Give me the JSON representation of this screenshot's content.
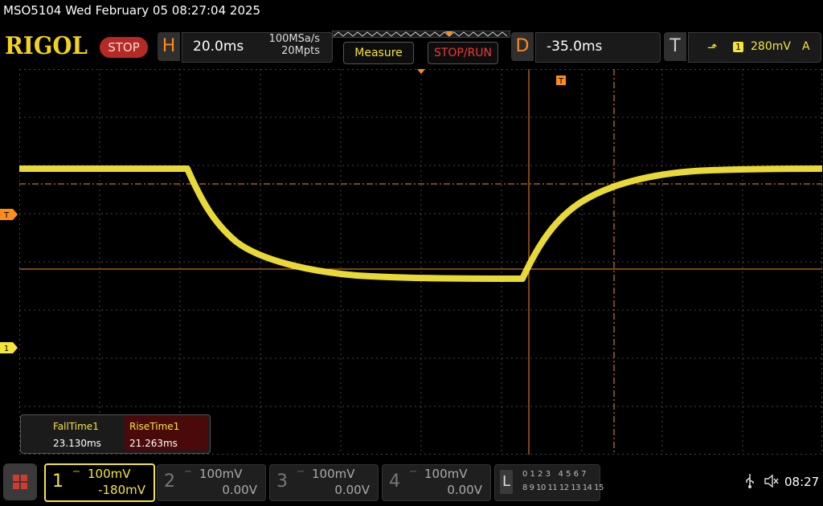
{
  "title": "MSO5104  Wed February 05 08:27:04 2025",
  "header": {
    "logo": "RIGOL",
    "run_state": "STOP",
    "horizontal": {
      "key": "H",
      "timebase": "20.0ms",
      "sample_rate": "100MSa/s",
      "memory_depth": "20Mpts"
    },
    "measure_label": "Measure",
    "stoprun_label": "STOP/RUN",
    "delay": {
      "key": "D",
      "value": "-35.0ms"
    },
    "trigger": {
      "key": "T",
      "edge": "rising-edge-icon",
      "edge_glyph": "⬏",
      "source": "1",
      "level": "280mV",
      "mode": "A"
    }
  },
  "screen": {
    "trigger_marker": "T",
    "ch1_marker": "1",
    "cursor_marker": "T",
    "colors": {
      "ch1": "#f5e53a",
      "cursor": "#ff8c1a",
      "grid": "#4a4a4a"
    }
  },
  "measurements": {
    "fall": {
      "name": "FallTime1",
      "value": "23.130ms"
    },
    "rise": {
      "name": "RiseTime1",
      "value": "21.263ms"
    }
  },
  "channels": [
    {
      "num": "1",
      "scale": "100mV",
      "offset": "-180mV",
      "active": true
    },
    {
      "num": "2",
      "scale": "100mV",
      "offset": "0.00V",
      "active": false
    },
    {
      "num": "3",
      "scale": "100mV",
      "offset": "0.00V",
      "active": false
    },
    {
      "num": "4",
      "scale": "100mV",
      "offset": "0.00V",
      "active": false
    }
  ],
  "logic": {
    "key": "L",
    "row1": "0 1 2 3   4 5 6 7",
    "row2": "8 9 10 11 12 13 14 15"
  },
  "status": {
    "usb_icon": "usb-icon",
    "speaker_icon": "speaker-muted-icon",
    "clock": "08:27"
  }
}
